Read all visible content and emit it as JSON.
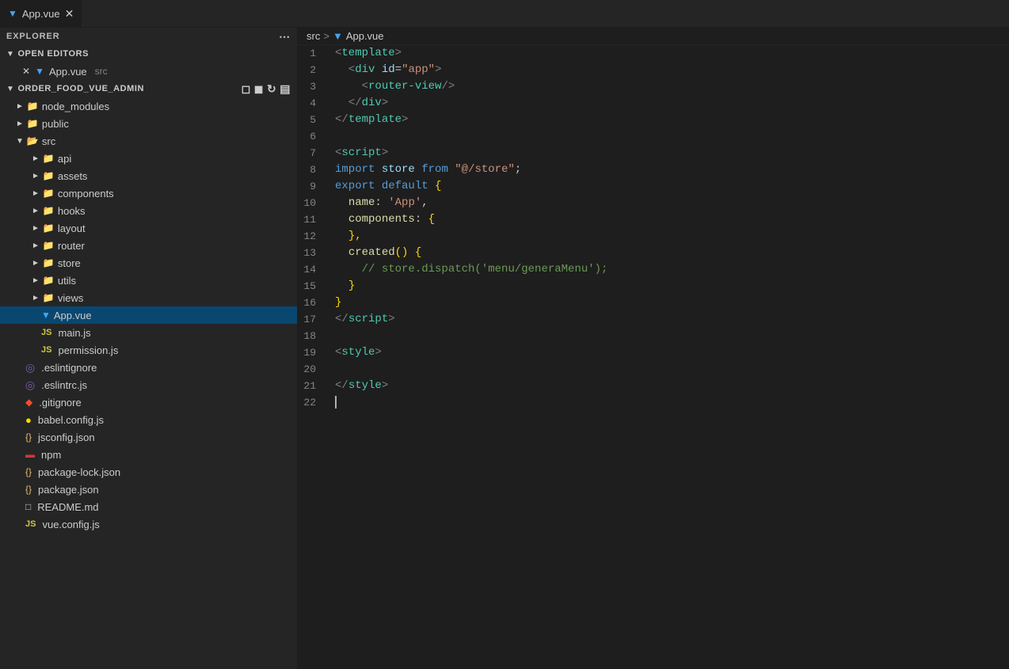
{
  "tabs": [
    {
      "id": "app-vue",
      "label": "App.vue",
      "type": "vue",
      "active": true,
      "closable": true
    }
  ],
  "breadcrumb": {
    "parts": [
      "src",
      "App.vue"
    ]
  },
  "sidebar": {
    "explorer_label": "EXPLORER",
    "open_editors_label": "OPEN EDITORS",
    "project_label": "ORDER_FOOD_VUE_ADMIN",
    "open_files": [
      {
        "id": "app-vue-open",
        "name": "App.vue",
        "path": "src",
        "type": "vue"
      }
    ],
    "tree": [
      {
        "id": "node_modules",
        "label": "node_modules",
        "type": "folder",
        "depth": 1,
        "expanded": false
      },
      {
        "id": "public",
        "label": "public",
        "type": "folder",
        "depth": 1,
        "expanded": false
      },
      {
        "id": "src",
        "label": "src",
        "type": "folder",
        "depth": 1,
        "expanded": true
      },
      {
        "id": "api",
        "label": "api",
        "type": "folder",
        "depth": 2,
        "expanded": false
      },
      {
        "id": "assets",
        "label": "assets",
        "type": "folder",
        "depth": 2,
        "expanded": false
      },
      {
        "id": "components",
        "label": "components",
        "type": "folder",
        "depth": 2,
        "expanded": false
      },
      {
        "id": "hooks",
        "label": "hooks",
        "type": "folder",
        "depth": 2,
        "expanded": false
      },
      {
        "id": "layout",
        "label": "layout",
        "type": "folder",
        "depth": 2,
        "expanded": false
      },
      {
        "id": "router",
        "label": "router",
        "type": "folder",
        "depth": 2,
        "expanded": false
      },
      {
        "id": "store",
        "label": "store",
        "type": "folder",
        "depth": 2,
        "expanded": false
      },
      {
        "id": "utils",
        "label": "utils",
        "type": "folder",
        "depth": 2,
        "expanded": false
      },
      {
        "id": "views",
        "label": "views",
        "type": "folder",
        "depth": 2,
        "expanded": false
      },
      {
        "id": "app-vue-tree",
        "label": "App.vue",
        "type": "vue",
        "depth": 2,
        "active": true
      },
      {
        "id": "main-js",
        "label": "main.js",
        "type": "js",
        "depth": 2
      },
      {
        "id": "permission-js",
        "label": "permission.js",
        "type": "js",
        "depth": 2
      },
      {
        "id": "eslintignore",
        "label": ".eslintignore",
        "type": "eslint",
        "depth": 1
      },
      {
        "id": "eslintrc-js",
        "label": ".eslintrc.js",
        "type": "eslint",
        "depth": 1
      },
      {
        "id": "gitignore",
        "label": ".gitignore",
        "type": "git",
        "depth": 1
      },
      {
        "id": "babel-config",
        "label": "babel.config.js",
        "type": "babel",
        "depth": 1
      },
      {
        "id": "jsconfig-json",
        "label": "jsconfig.json",
        "type": "json",
        "depth": 1
      },
      {
        "id": "npm",
        "label": "npm",
        "type": "npm",
        "depth": 1
      },
      {
        "id": "package-lock-json",
        "label": "package-lock.json",
        "type": "json",
        "depth": 1
      },
      {
        "id": "package-json",
        "label": "package.json",
        "type": "json",
        "depth": 1
      },
      {
        "id": "readme",
        "label": "README.md",
        "type": "readme",
        "depth": 1
      },
      {
        "id": "vue-config-js",
        "label": "vue.config.js",
        "type": "js",
        "depth": 1
      }
    ]
  },
  "code": {
    "lines": [
      {
        "num": 1,
        "tokens": [
          {
            "t": "angle",
            "v": "<"
          },
          {
            "t": "tag",
            "v": "template"
          },
          {
            "t": "angle",
            "v": ">"
          }
        ]
      },
      {
        "num": 2,
        "tokens": [
          {
            "t": "plain",
            "v": "  "
          },
          {
            "t": "angle",
            "v": "<"
          },
          {
            "t": "tag",
            "v": "div"
          },
          {
            "t": "plain",
            "v": " "
          },
          {
            "t": "attr",
            "v": "id"
          },
          {
            "t": "plain",
            "v": "="
          },
          {
            "t": "aval",
            "v": "\"app\""
          },
          {
            "t": "angle",
            "v": ">"
          }
        ]
      },
      {
        "num": 3,
        "tokens": [
          {
            "t": "plain",
            "v": "    "
          },
          {
            "t": "angle",
            "v": "<"
          },
          {
            "t": "tag",
            "v": "router-view"
          },
          {
            "t": "angle",
            "v": "/>"
          }
        ]
      },
      {
        "num": 4,
        "tokens": [
          {
            "t": "plain",
            "v": "  "
          },
          {
            "t": "angle",
            "v": "</"
          },
          {
            "t": "tag",
            "v": "div"
          },
          {
            "t": "angle",
            "v": ">"
          }
        ]
      },
      {
        "num": 5,
        "tokens": [
          {
            "t": "angle",
            "v": "</"
          },
          {
            "t": "tag",
            "v": "template"
          },
          {
            "t": "angle",
            "v": ">"
          }
        ]
      },
      {
        "num": 6,
        "tokens": []
      },
      {
        "num": 7,
        "tokens": [
          {
            "t": "angle",
            "v": "<"
          },
          {
            "t": "tag",
            "v": "script"
          },
          {
            "t": "angle",
            "v": ">"
          }
        ]
      },
      {
        "num": 8,
        "tokens": [
          {
            "t": "keyword",
            "v": "import"
          },
          {
            "t": "plain",
            "v": " "
          },
          {
            "t": "var",
            "v": "store"
          },
          {
            "t": "plain",
            "v": " "
          },
          {
            "t": "keyword",
            "v": "from"
          },
          {
            "t": "plain",
            "v": " "
          },
          {
            "t": "string",
            "v": "\"@/store\""
          },
          {
            "t": "plain",
            "v": ";"
          }
        ]
      },
      {
        "num": 9,
        "tokens": [
          {
            "t": "keyword",
            "v": "export"
          },
          {
            "t": "plain",
            "v": " "
          },
          {
            "t": "keyword",
            "v": "default"
          },
          {
            "t": "plain",
            "v": " "
          },
          {
            "t": "brace",
            "v": "{"
          }
        ]
      },
      {
        "num": 10,
        "tokens": [
          {
            "t": "plain",
            "v": "  "
          },
          {
            "t": "func",
            "v": "name"
          },
          {
            "t": "plain",
            "v": ": "
          },
          {
            "t": "nameval",
            "v": "'App'"
          },
          {
            "t": "plain",
            "v": ","
          }
        ]
      },
      {
        "num": 11,
        "tokens": [
          {
            "t": "plain",
            "v": "  "
          },
          {
            "t": "func",
            "v": "components"
          },
          {
            "t": "plain",
            "v": ": "
          },
          {
            "t": "brace",
            "v": "{"
          }
        ]
      },
      {
        "num": 12,
        "tokens": [
          {
            "t": "plain",
            "v": "  "
          },
          {
            "t": "brace",
            "v": "},"
          }
        ]
      },
      {
        "num": 13,
        "tokens": [
          {
            "t": "plain",
            "v": "  "
          },
          {
            "t": "func",
            "v": "created"
          },
          {
            "t": "paren",
            "v": "()"
          },
          {
            "t": "plain",
            "v": " "
          },
          {
            "t": "brace",
            "v": "{"
          }
        ]
      },
      {
        "num": 14,
        "tokens": [
          {
            "t": "plain",
            "v": "    "
          },
          {
            "t": "comment",
            "v": "// store.dispatch('menu/generaMenu');"
          }
        ]
      },
      {
        "num": 15,
        "tokens": [
          {
            "t": "plain",
            "v": "  "
          },
          {
            "t": "brace",
            "v": "}"
          }
        ]
      },
      {
        "num": 16,
        "tokens": [
          {
            "t": "brace",
            "v": "}"
          }
        ]
      },
      {
        "num": 17,
        "tokens": [
          {
            "t": "angle",
            "v": "</"
          },
          {
            "t": "tag",
            "v": "script"
          },
          {
            "t": "angle",
            "v": ">"
          }
        ]
      },
      {
        "num": 18,
        "tokens": []
      },
      {
        "num": 19,
        "tokens": [
          {
            "t": "angle",
            "v": "<"
          },
          {
            "t": "tag",
            "v": "style"
          },
          {
            "t": "angle",
            "v": ">"
          }
        ]
      },
      {
        "num": 20,
        "tokens": []
      },
      {
        "num": 21,
        "tokens": [
          {
            "t": "angle",
            "v": "</"
          },
          {
            "t": "tag",
            "v": "style"
          },
          {
            "t": "angle",
            "v": ">"
          }
        ]
      },
      {
        "num": 22,
        "tokens": []
      }
    ]
  }
}
